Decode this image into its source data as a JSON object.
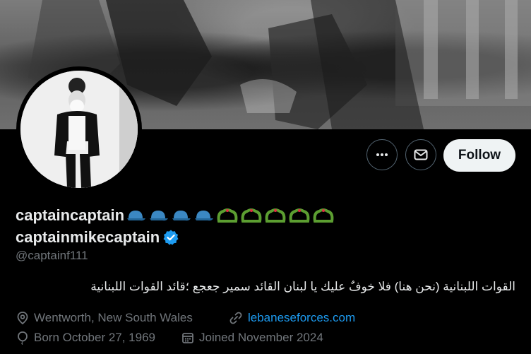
{
  "profile": {
    "display_name_line1": "captaincaptain",
    "display_name_line2": "captainmikecaptain",
    "handle": "@captainf111",
    "bio": "القوات اللبنانية (نحن هنا) فلا خوفٌ عليك يا لبنان القائد سمير جعجع ؛قائد القوات اللبنانية",
    "location": "Wentworth, New South Wales",
    "website": "lebaneseforces.com",
    "birthday": "Born October 27, 1969",
    "joined": "Joined November 2024",
    "verified": true,
    "name_emojis": [
      "blue-cap",
      "blue-cap",
      "blue-cap",
      "blue-cap",
      "cedar",
      "cedar",
      "cedar",
      "cedar",
      "cedar"
    ]
  },
  "actions": {
    "more_icon": "more-icon",
    "message_icon": "mail-icon",
    "follow_label": "Follow"
  },
  "colors": {
    "background": "#000000",
    "text": "#e7e9ea",
    "muted": "#71767b",
    "link": "#1d9bf0",
    "verified": "#1d9bf0",
    "follow_bg": "#eff3f4"
  }
}
